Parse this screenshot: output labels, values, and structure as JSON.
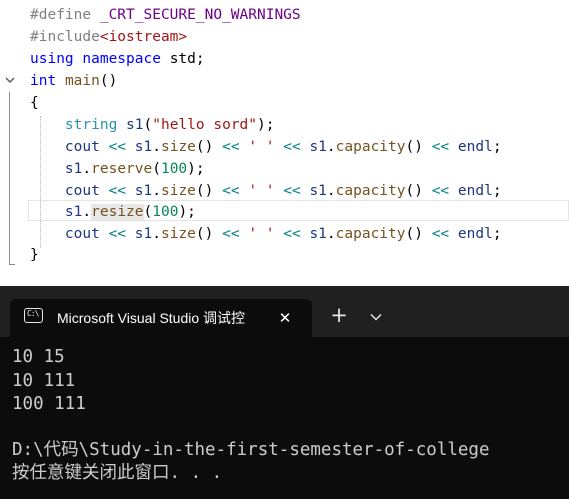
{
  "editor": {
    "lines": {
      "l1": {
        "directive": "#define",
        "macro": "_CRT_SECURE_NO_WARNINGS"
      },
      "l2": {
        "directive": "#include",
        "header": "<iostream>"
      },
      "l3": {
        "kw1": "using",
        "kw2": "namespace",
        "ns": "std",
        "semi": ";"
      },
      "l4": {
        "type": "int",
        "name": "main",
        "parens": "()"
      },
      "l5": {
        "text": "{"
      },
      "l6": {
        "type": "string",
        "var": "s1",
        "open": "(",
        "literal": "\"hello sord\"",
        "close": ");"
      },
      "l7": {
        "cout": "cout",
        "op": "<<",
        "obj": "s1",
        "fn1": "size",
        "call": "()",
        "sp": "' '",
        "fn2": "capacity",
        "endl": "endl",
        "semi": ";"
      },
      "l8": {
        "obj": "s1",
        "fn": "reserve",
        "open": "(",
        "num": "100",
        "close": ");"
      },
      "l9": {
        "cout": "cout",
        "op": "<<",
        "obj": "s1",
        "fn1": "size",
        "call": "()",
        "sp": "' '",
        "fn2": "capacity",
        "endl": "endl",
        "semi": ";"
      },
      "l10": {
        "obj": "s1",
        "fn": "resize",
        "open": "(",
        "num": "100",
        "close": ");"
      },
      "l11": {
        "cout": "cout",
        "op": "<<",
        "obj": "s1",
        "fn1": "size",
        "call": "()",
        "sp": "' '",
        "fn2": "capacity",
        "endl": "endl",
        "semi": ";"
      },
      "l12": {
        "text": "}"
      }
    },
    "fold_icon": "chevron-down-icon"
  },
  "terminal": {
    "tab": {
      "icon": "console-icon",
      "icon_text": "C:\\",
      "title": "Microsoft Visual Studio 调试控",
      "close": "✕"
    },
    "new_tab": "+",
    "dropdown_icon": "chevron-down-icon",
    "output": [
      "10 15",
      "10 111",
      "100 111",
      "",
      "D:\\代码\\Study-in-the-first-semester-of-college",
      "按任意键关闭此窗口. . ."
    ]
  }
}
